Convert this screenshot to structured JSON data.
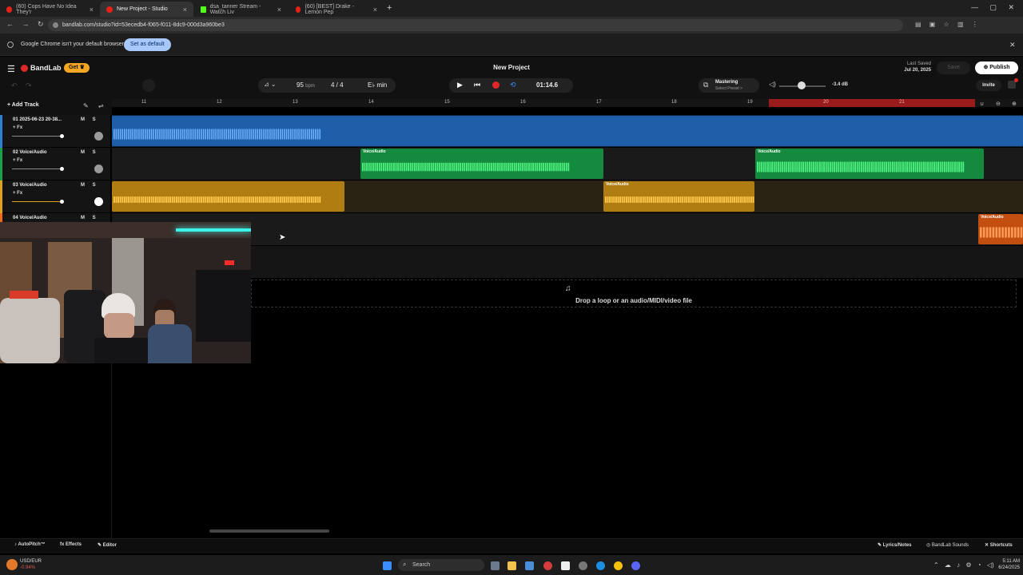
{
  "browser": {
    "tabs": [
      {
        "title": "(60) Cops Have No Idea They'r",
        "color": "#e62117"
      },
      {
        "title": "New Project - Studio",
        "color": "#e62117"
      },
      {
        "title": "dsa_tanner Stream - Watch Liv",
        "color": "#53fc18"
      },
      {
        "title": "(60) [BEST] Drake - Lemon Pep",
        "color": "#e62117"
      }
    ],
    "url": "bandlab.com/studio?id=53ecedb4-f065-f011-8dc9-000d3a960be3",
    "infobar_text": "Google Chrome isn't your default browser",
    "infobar_button": "Set as default"
  },
  "studio": {
    "logo": "BandLab",
    "get_button": "Get",
    "project_title": "New Project",
    "last_saved_label": "Last Saved",
    "last_saved_date": "Jul 20, 2025",
    "save_button": "Save",
    "publish_button": "Publish",
    "invite_button": "Invite",
    "bpm_value": "95",
    "bpm_unit": "bpm",
    "time_signature": "4 / 4",
    "key": "E♭ min",
    "time_display": "01:14.6",
    "mastering_label": "Mastering",
    "mastering_preset": "Select Preset >",
    "volume_db": "-3.4 dB",
    "add_track": "Add Track",
    "drop_text": "Drop a loop or an audio/MIDI/video file"
  },
  "ruler": {
    "bars": [
      "11",
      "12",
      "13",
      "14",
      "15",
      "16",
      "17",
      "18",
      "19",
      "20",
      "21"
    ]
  },
  "tracks": [
    {
      "name": "01  2025-06-23 20-38...",
      "fx": "+ Fx",
      "ms": "M S",
      "color": "#2f7ed8"
    },
    {
      "name": "02  Voice/Audio",
      "fx": "+ Fx",
      "ms": "M S",
      "color": "#17a34a"
    },
    {
      "name": "03  Voice/Audio",
      "fx": "+ Fx",
      "ms": "M S",
      "color": "#e0a21b"
    },
    {
      "name": "04  Voice/Audio",
      "fx": "",
      "ms": "M S",
      "color": "#f06a1a"
    }
  ],
  "clip_label": "Voice/Audio",
  "footer": {
    "autopitch": "AutoPitch™",
    "effects": "Effects",
    "editor": "Editor",
    "lyrics": "Lyrics/Notes",
    "sounds": "BandLab Sounds",
    "shortcuts": "Shortcuts"
  },
  "taskbar": {
    "ticker": "USD/EUR",
    "ticker_change": "-0.94%",
    "search": "Search",
    "time": "5:11 AM",
    "date": "6/24/2025"
  },
  "colors": {
    "accent_blue": "#2f7ed8",
    "accent_green": "#17a34a",
    "accent_yellow": "#e0a21b",
    "accent_orange": "#f06a1a",
    "record_red": "#e0282a",
    "loop_region": "#9a1b1b"
  }
}
